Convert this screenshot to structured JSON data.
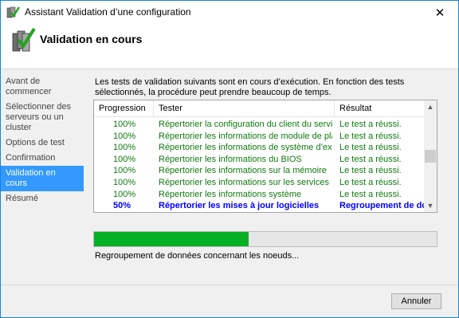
{
  "window": {
    "title": "Assistant Validation d’une configuration",
    "close_glyph": "✕"
  },
  "header": {
    "title": "Validation en cours",
    "icon": "cluster-validation-icon"
  },
  "sidebar": {
    "items": [
      {
        "label": "Avant de commencer",
        "active": false
      },
      {
        "label": "Sélectionner des serveurs ou un cluster",
        "active": false
      },
      {
        "label": "Options de test",
        "active": false
      },
      {
        "label": "Confirmation",
        "active": false
      },
      {
        "label": "Validation en cours",
        "active": true
      },
      {
        "label": "Résumé",
        "active": false
      }
    ]
  },
  "main": {
    "intro": "Les tests de validation suivants sont en cours d’exécution. En fonction des tests sélectionnés, la procédure peut prendre beaucoup de temps.",
    "table": {
      "columns": [
        "Progression",
        "Tester",
        "Résultat"
      ],
      "rows": [
        {
          "progress": "100%",
          "test": "Répertorier la configuration du client du service Gu...",
          "result": "Le test a réussi."
        },
        {
          "progress": "100%",
          "test": "Répertorier les informations de module de plateform...",
          "result": "Le test a réussi."
        },
        {
          "progress": "100%",
          "test": "Répertorier les informations de système d’exploitation",
          "result": "Le test a réussi."
        },
        {
          "progress": "100%",
          "test": "Répertorier les informations du BIOS",
          "result": "Le test a réussi."
        },
        {
          "progress": "100%",
          "test": "Répertorier les informations sur la mémoire",
          "result": "Le test a réussi."
        },
        {
          "progress": "100%",
          "test": "Répertorier les informations sur les services",
          "result": "Le test a réussi."
        },
        {
          "progress": "100%",
          "test": "Répertorier les informations système",
          "result": "Le test a réussi."
        },
        {
          "progress": "50%",
          "test": "Répertorier les mises à jour logicielles",
          "result": "Regroupement de don"
        }
      ]
    },
    "progress_fraction": 0.45,
    "status_text": "Regroupement de données concernant les noeuds..."
  },
  "footer": {
    "cancel_label": "Annuler"
  },
  "colors": {
    "accent": "#3399ff",
    "success_text": "#0f7b0f",
    "current_text": "#0000ff",
    "progress_fill": "#06b025"
  }
}
